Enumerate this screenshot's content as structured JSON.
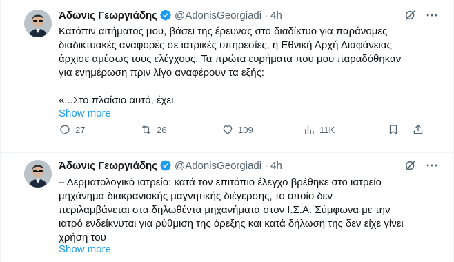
{
  "tweets": [
    {
      "author_name": "Άδωνις Γεωργιάδης",
      "handle": "@AdonisGeorgiadi",
      "separator": "·",
      "time": "4h",
      "text": "Κατόπιν αιτήματος μου, βάσει της έρευνας στο διαδίκτυο για παράνομες\nδιαδικτυακές αναφορές σε ιατρικές υπηρεσίες, η Εθνική Αρχή Διαφάνειας\nάρχισε αμέσως τους ελέγχους. Τα πρώτα ευρήματα που μου παραδόθηκαν\nγια ενημέρωση πριν λίγο αναφέρουν τα εξής:\n\n«...Στο πλαίσιο αυτό, έχει",
      "show_more": "Show more",
      "replies": "27",
      "retweets": "26",
      "likes": "109",
      "views": "11K"
    },
    {
      "author_name": "Άδωνις Γεωργιάδης",
      "handle": "@AdonisGeorgiadi",
      "separator": "·",
      "time": "4h",
      "text": "– Δερματολογικό ιατρείο: κατά τον επιτόπιο έλεγχο βρέθηκε στο ιατρείο\nμηχάνημα διακρανιακής μαγνητικής διέγερσης, το οποίο δεν\nπεριλαμβάνεται στα δηλωθέντα μηχανήματα στον Ι.Σ.Α. Σύμφωνα με την\nιατρό ενδείκνυται για ρύθμιση της όρεξης και κατά δήλωση της δεν είχε γίνει\nχρήση του",
      "show_more": "Show more"
    }
  ],
  "icons": {
    "verified": "verified-badge-icon",
    "grok": "grok-icon",
    "more": "more-icon",
    "reply": "reply-icon",
    "retweet": "retweet-icon",
    "like": "like-icon",
    "views": "views-icon",
    "bookmark": "bookmark-icon",
    "share": "share-icon"
  },
  "colors": {
    "accent": "#1d9bf0",
    "text": "#0f1419",
    "secondary": "#536471",
    "border": "#eff3f4"
  }
}
